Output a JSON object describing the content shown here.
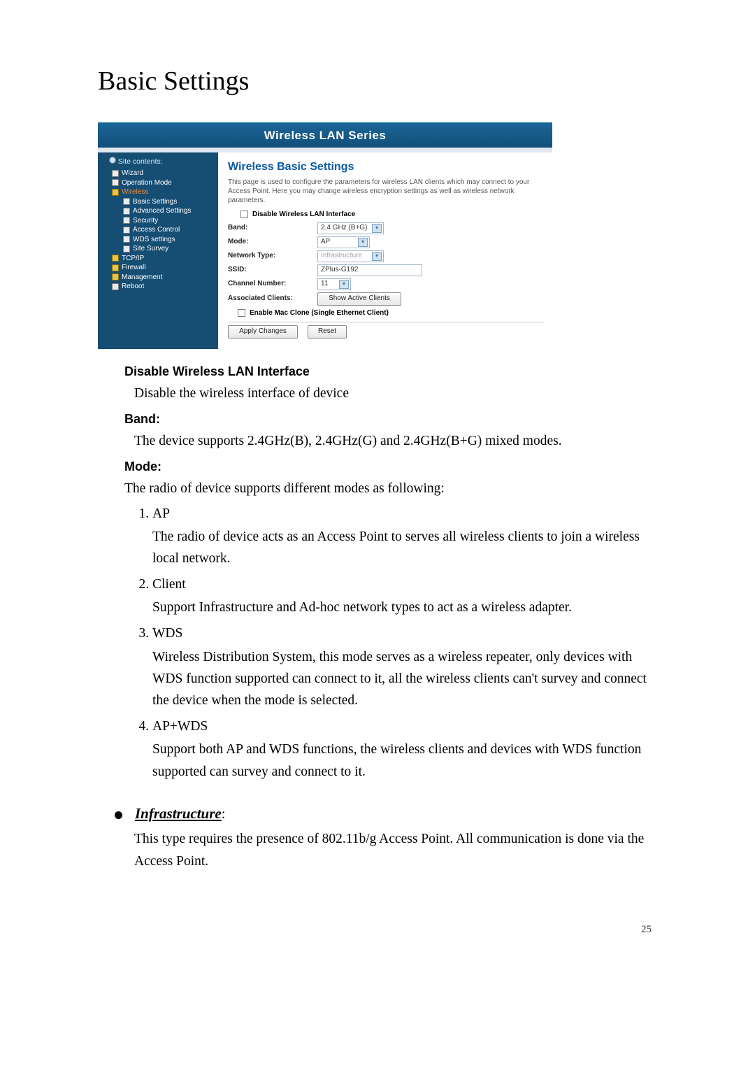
{
  "page": {
    "title": "Basic Settings",
    "page_number": "25"
  },
  "screenshot": {
    "header": "Wireless LAN Series",
    "sidebar": {
      "title": "Site contents:",
      "items": [
        {
          "label": "Wizard",
          "icon": "doc",
          "sub": false
        },
        {
          "label": "Operation Mode",
          "icon": "doc",
          "sub": false
        },
        {
          "label": "Wireless",
          "icon": "folder",
          "sub": false,
          "active": true
        },
        {
          "label": "Basic Settings",
          "icon": "doc",
          "sub": true
        },
        {
          "label": "Advanced Settings",
          "icon": "doc",
          "sub": true
        },
        {
          "label": "Security",
          "icon": "doc",
          "sub": true
        },
        {
          "label": "Access Control",
          "icon": "doc",
          "sub": true
        },
        {
          "label": "WDS settings",
          "icon": "doc",
          "sub": true
        },
        {
          "label": "Site Survey",
          "icon": "doc",
          "sub": true
        },
        {
          "label": "TCP/IP",
          "icon": "folder",
          "sub": false
        },
        {
          "label": "Firewall",
          "icon": "folder",
          "sub": false
        },
        {
          "label": "Management",
          "icon": "folder",
          "sub": false
        },
        {
          "label": "Reboot",
          "icon": "doc",
          "sub": false
        }
      ]
    },
    "main": {
      "title": "Wireless Basic Settings",
      "desc": "This page is used to configure the parameters for wireless LAN clients which may connect to your Access Point. Here you may change wireless encryption settings as well as wireless network parameters.",
      "disable_label": "Disable Wireless LAN Interface",
      "form": {
        "band_label": "Band:",
        "band_value": "2.4 GHz (B+G)",
        "mode_label": "Mode:",
        "mode_value": "AP",
        "ntype_label": "Network Type:",
        "ntype_value": "Infrastructure",
        "ssid_label": "SSID:",
        "ssid_value": "ZPlus-G192",
        "channel_label": "Channel Number:",
        "channel_value": "11",
        "assoc_label": "Associated Clients:",
        "assoc_btn": "Show Active Clients",
        "mac_clone_label": "Enable Mac Clone (Single Ethernet Client)",
        "apply_btn": "Apply Changes",
        "reset_btn": "Reset"
      }
    }
  },
  "doc": {
    "dwli_head": "Disable Wireless LAN Interface",
    "dwli_body": "Disable the wireless interface of device",
    "band_head": "Band:",
    "band_body": "The device supports 2.4GHz(B), 2.4GHz(G) and 2.4GHz(B+G) mixed modes.",
    "mode_head": "Mode:",
    "mode_body": "The radio of device supports different modes as following:",
    "items": [
      {
        "t": "AP",
        "b": "The radio of device acts as an Access Point to serves all wireless clients to join a wireless local network."
      },
      {
        "t": "Client",
        "b": "Support Infrastructure and Ad-hoc network types to act as a wireless adapter."
      },
      {
        "t": "WDS",
        "b": "Wireless Distribution System, this mode serves as a wireless repeater, only devices with WDS function supported can connect to it, all the wireless clients can't survey and connect the device when the mode is selected."
      },
      {
        "t": "AP+WDS",
        "b": "Support both AP and WDS functions, the wireless clients and devices with WDS function supported can survey and connect to it."
      }
    ],
    "infra_head": "Infrastructure",
    "infra_colon": ":",
    "infra_body": "This type requires the presence of 802.11b/g Access Point. All communication is done via the Access Point."
  }
}
